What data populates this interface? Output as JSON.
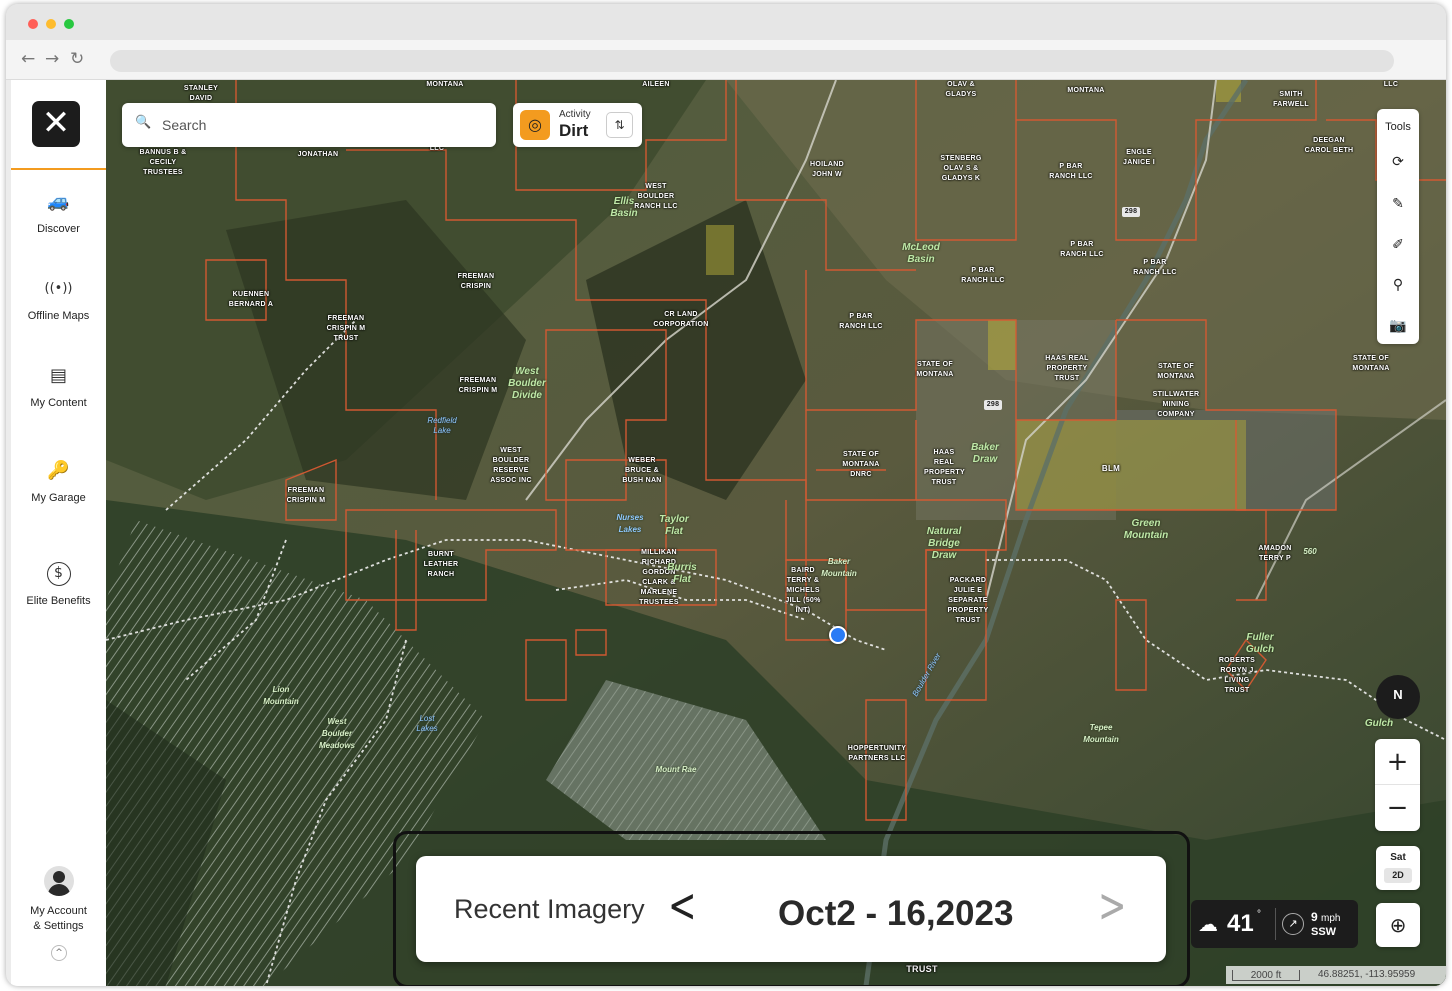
{
  "browser": {
    "dots": [
      "#ff5f57",
      "#febc2e",
      "#28c840"
    ],
    "back": "←",
    "forward": "→",
    "reload": "↻"
  },
  "sidebar": {
    "logo": "✕",
    "items": [
      {
        "label": "Discover",
        "icon": "🚙"
      },
      {
        "label": "Offline Maps",
        "icon": "((•))"
      },
      {
        "label": "My Content",
        "icon": "▤"
      },
      {
        "label": "My Garage",
        "icon": "🔑"
      },
      {
        "label": "Elite Benefits",
        "icon": "$"
      }
    ],
    "account_line1": "My Account",
    "account_line2": "& Settings",
    "collapse": "^"
  },
  "search": {
    "placeholder": "Search",
    "icon": "🔍"
  },
  "activity": {
    "small": "Activity",
    "value": "Dirt",
    "icon": "◎",
    "filter_icon": "⇅"
  },
  "tools": {
    "title": "Tools",
    "items": [
      "⟳",
      "✎",
      "✐",
      "⚲",
      "📷"
    ]
  },
  "compass": {
    "label": "N"
  },
  "zoom": {
    "in": "+",
    "out": "−"
  },
  "layers": {
    "mode": "Sat",
    "view": "2D"
  },
  "locate": {
    "icon": "⊕"
  },
  "weather": {
    "temp": "41",
    "deg": "°",
    "speed": "9",
    "unit": "mph",
    "dir": "SSW",
    "cloud_icon": "☁",
    "wind_icon": "↗"
  },
  "scale": {
    "distance": "2000 ft",
    "coords": "46.88251, -113.95959"
  },
  "imagery": {
    "label": "Recent Imagery",
    "prev": "<",
    "date": "Oct2 - 16,2023",
    "next": ">"
  },
  "map": {
    "owners": [
      "STANLEY DAVID",
      "MONTANA",
      "AILEEN",
      "OLAV & GLADYS",
      "MONTANA",
      "SMITH FARWELL",
      "LLC",
      "BANNUS B & CECILY TRUSTEES",
      "JONATHAN",
      "LLC",
      "HOILAND JOHN W",
      "STENBERG OLAV S & GLADYS K",
      "P BAR RANCH LLC",
      "ENGLE JANICE I",
      "DEEGAN CAROL BETH",
      "WEST BOULDER RANCH LLC",
      "P BAR RANCH LLC",
      "P BAR RANCH LLC",
      "P BAR RANCH LLC",
      "KUENNEN BERNARD A",
      "FREEMAN CRISPIN",
      "FREEMAN CRISPIN M TRUST",
      "CR LAND CORPORATION",
      "P BAR RANCH LLC",
      "STATE OF MONTANA",
      "HAAS REAL PROPERTY TRUST",
      "STATE OF MONTANA",
      "STATE OF MONTANA",
      "STILLWATER MINING COMPANY",
      "FREEMAN CRISPIN M",
      "WEST BOULDER RESERVE ASSOC INC",
      "WEBER BRUCE & BUSH NAN",
      "STATE OF MONTANA DNRC",
      "HAAS REAL PROPERTY TRUST",
      "BLM",
      "FREEMAN CRISPIN M",
      "AMADON TERRY P",
      "BURNT LEATHER RANCH",
      "MILLIKAN RICHARD GORDON CLARK & MARLENE TRUSTEES",
      "BAIRD TERRY & MICHELS JILL (50% INT)",
      "PACKARD JULIE E SEPARATE PROPERTY TRUST",
      "ROBERTS ROBYN J LIVING TRUST",
      "HOPPERTUNITY PARTNERS LLC",
      "TRUST"
    ],
    "places": [
      "Ellis Basin",
      "McLeod Basin",
      "West Boulder Divide",
      "Taylor Flat",
      "Baker Draw",
      "Green Mountain",
      "Natural Bridge Draw",
      "Burris Flat",
      "Fuller Gulch",
      "Gulch"
    ],
    "small_places": [
      "Baker Mountain",
      "Lion Mountain",
      "West Boulder Meadows",
      "Mount Rae",
      "Tepee Mountain",
      "Nurses Lakes"
    ],
    "water": [
      "Redfield Lake",
      "Lost Lakes",
      "Boulder River"
    ],
    "roads": [
      "298",
      "298",
      "560"
    ]
  }
}
